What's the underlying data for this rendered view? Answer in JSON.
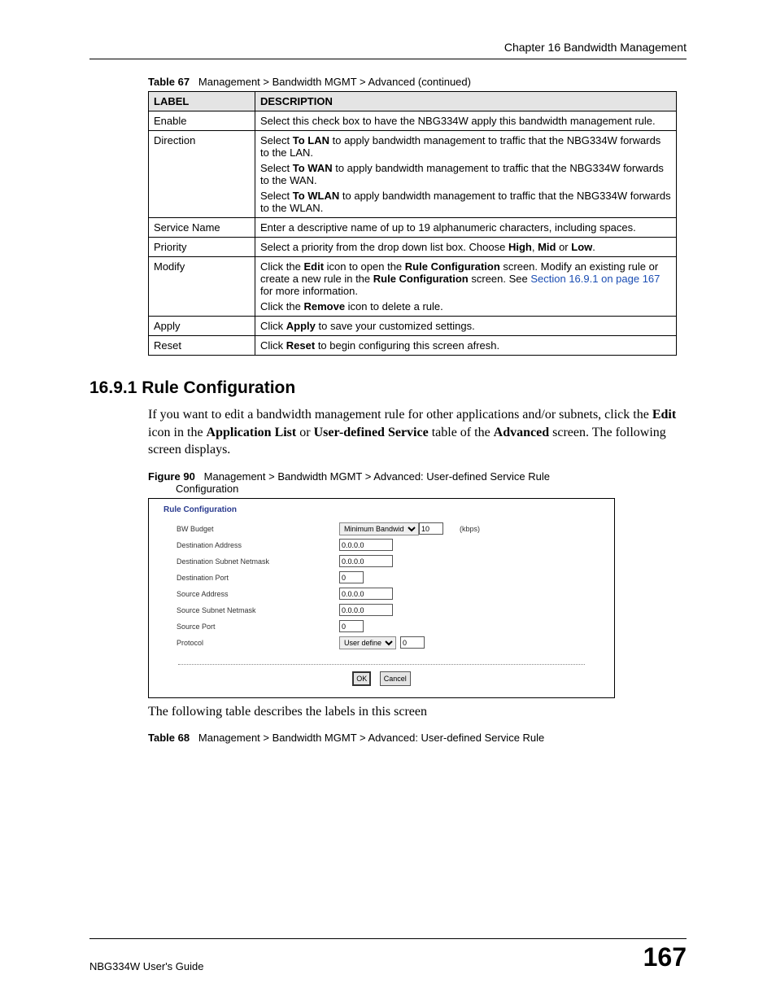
{
  "chapter_header": "Chapter 16 Bandwidth Management",
  "table67": {
    "caption_num": "Table 67",
    "caption_text": "Management > Bandwidth MGMT > Advanced  (continued)",
    "head_label": "LABEL",
    "head_desc": "DESCRIPTION",
    "rows": {
      "enable": {
        "label": "Enable",
        "desc": "Select this check box to have the NBG334W apply this bandwidth management rule."
      },
      "direction": {
        "label": "Direction",
        "p1a": "Select ",
        "p1b": "To LAN",
        "p1c": " to apply bandwidth management to traffic that the NBG334W forwards to the LAN.",
        "p2a": "Select ",
        "p2b": "To WAN",
        "p2c": " to apply bandwidth management to traffic that the NBG334W forwards to the WAN.",
        "p3a": "Select ",
        "p3b": "To WLAN",
        "p3c": " to apply bandwidth management to traffic that the NBG334W forwards to the WLAN."
      },
      "service_name": {
        "label": "Service Name",
        "desc": "Enter a descriptive name of up to 19 alphanumeric characters, including spaces."
      },
      "priority": {
        "label": "Priority",
        "a": "Select a priority from the drop down list box. Choose ",
        "b": "High",
        "c": ", ",
        "d": "Mid",
        "e": " or ",
        "f": "Low",
        "g": "."
      },
      "modify": {
        "label": "Modify",
        "p1a": "Click the ",
        "p1b": "Edit",
        "p1c": " icon to open the ",
        "p1d": "Rule Configuration",
        "p1e": " screen. Modify an existing rule or create a new rule in the ",
        "p1f": "Rule Configuration",
        "p1g": " screen. See ",
        "p1h": "Section 16.9.1 on page 167",
        "p1i": " for more information.",
        "p2a": "Click the ",
        "p2b": "Remove",
        "p2c": " icon to delete a rule."
      },
      "apply": {
        "label": "Apply",
        "a": "Click ",
        "b": "Apply",
        "c": " to save your customized settings."
      },
      "reset": {
        "label": "Reset",
        "a": "Click ",
        "b": "Reset",
        "c": " to begin configuring this screen afresh."
      }
    }
  },
  "section_title": "16.9.1  Rule Configuration",
  "para1_a": "If you want to edit a bandwidth management rule for other applications and/or subnets, click the ",
  "para1_b": "Edit",
  "para1_c": " icon in the ",
  "para1_d": "Application List",
  "para1_e": " or ",
  "para1_f": "User-defined Service",
  "para1_g": " table of the ",
  "para1_h": "Advanced",
  "para1_i": " screen. The following screen displays.",
  "figure90": {
    "num": "Figure 90",
    "text1": "Management > Bandwidth MGMT > Advanced: User-defined Service Rule",
    "text2": "Configuration",
    "panel_title": "Rule Configuration",
    "labels": {
      "bw": "BW Budget",
      "dest_addr": "Destination Address",
      "dest_mask": "Destination Subnet Netmask",
      "dest_port": "Destination Port",
      "src_addr": "Source Address",
      "src_mask": "Source Subnet Netmask",
      "src_port": "Source Port",
      "proto": "Protocol"
    },
    "selects": {
      "bw_mode": "Minimum Bandwidth",
      "proto": "User defined"
    },
    "values": {
      "bw_val": "10",
      "dest_addr": "0.0.0.0",
      "dest_mask": "0.0.0.0",
      "dest_port": "0",
      "src_addr": "0.0.0.0",
      "src_mask": "0.0.0.0",
      "src_port": "0",
      "proto_num": "0"
    },
    "unit": "(kbps)",
    "btn_ok": "OK",
    "btn_cancel": "Cancel"
  },
  "para2": "The following table describes the labels in this screen",
  "table68": {
    "num": "Table 68",
    "text": "Management > Bandwidth MGMT > Advanced: User-defined Service Rule"
  },
  "footer_left": "NBG334W User's Guide",
  "footer_page": "167"
}
